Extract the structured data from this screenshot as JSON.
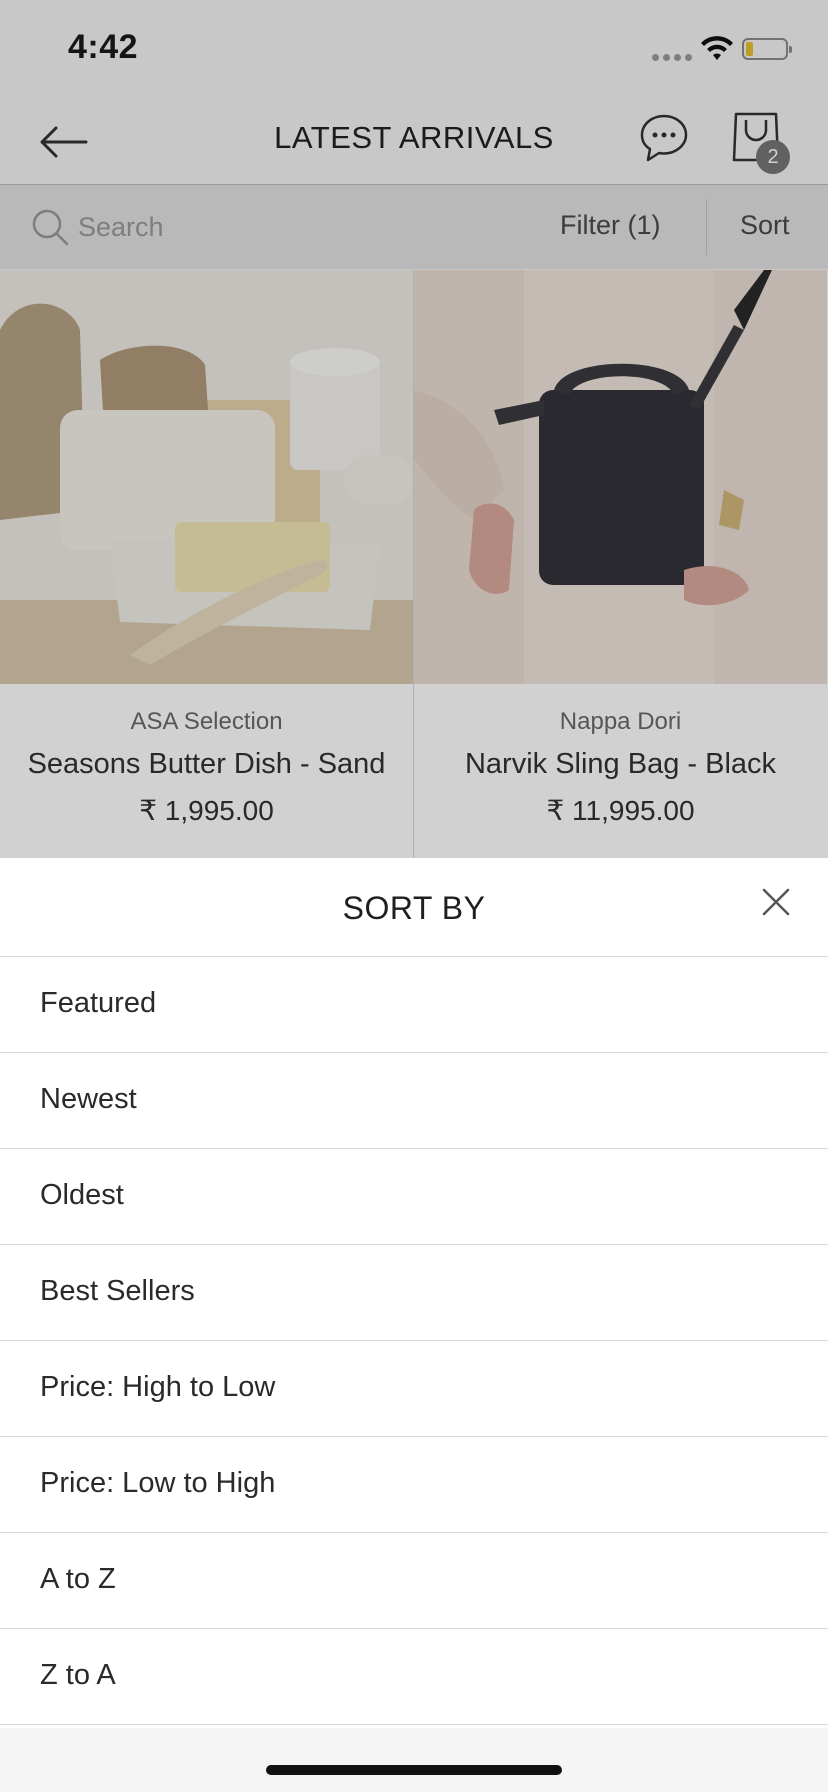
{
  "status_bar": {
    "time": "4:42",
    "battery_color": "#e6c22f"
  },
  "nav": {
    "title": "LATEST ARRIVALS",
    "back_icon": "arrow-left-icon",
    "chat_icon": "chat-bubble-icon",
    "bag_icon": "shopping-bag-icon",
    "bag_count": "2"
  },
  "search": {
    "placeholder": "Search",
    "filter_label": "Filter (1)",
    "sort_label": "Sort"
  },
  "products": [
    {
      "brand": "ASA Selection",
      "name": "Seasons Butter Dish - Sand",
      "price": "₹ 1,995.00"
    },
    {
      "brand": "Nappa Dori",
      "name": "Narvik Sling Bag - Black",
      "price": "₹ 11,995.00"
    }
  ],
  "sort_sheet": {
    "title": "SORT BY",
    "close_icon": "close-icon",
    "options": [
      "Featured",
      "Newest",
      "Oldest",
      "Best Sellers",
      "Price: High to Low",
      "Price: Low to High",
      "A to Z",
      "Z to A"
    ]
  }
}
